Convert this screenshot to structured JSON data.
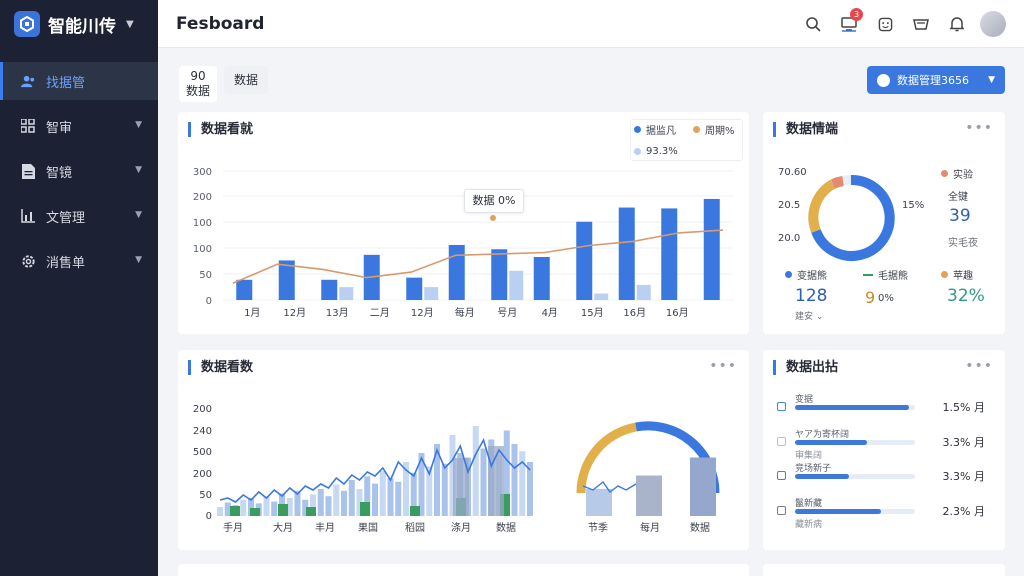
{
  "brand": {
    "name": "智能川传"
  },
  "sidebar": {
    "items": [
      {
        "label": "找据管",
        "icon": "users-icon",
        "active": true
      },
      {
        "label": "智审",
        "icon": "grid-icon",
        "active": false
      },
      {
        "label": "智镜",
        "icon": "document-icon",
        "active": false
      },
      {
        "label": "文管理",
        "icon": "bar-chart-icon",
        "active": false
      },
      {
        "label": "消售单",
        "icon": "gear-icon",
        "active": false
      }
    ]
  },
  "topbar": {
    "title": "Fesboard",
    "notification_count": "3"
  },
  "subheader": {
    "pill_a_num": "90",
    "pill_a_label": "数据",
    "pill_b_label": "数据",
    "primary_button": "数据管理3656"
  },
  "colors": {
    "accent": "#3a78e0",
    "orange": "#e0a35a",
    "light_blue": "#b9d0f2",
    "green": "#3a9d5f",
    "gold": "#e2b04a"
  },
  "card1": {
    "title": "数据看就",
    "legend": [
      {
        "label": "据监凡",
        "color": "#3a78e0"
      },
      {
        "label": "周期%",
        "color": "#e0a35a"
      },
      {
        "label": "93.3%",
        "color": "#b9d0f2"
      }
    ],
    "tooltip": "数据 0%"
  },
  "card2": {
    "title": "数据情端",
    "ring_labels": [
      "70.60",
      "20.5",
      "20.0"
    ],
    "ring_pct": "15%",
    "side_legend": "实验",
    "side_label": "全键",
    "side_value": "39",
    "side_sub": "实毛夜",
    "stats": [
      {
        "label": "变据熊",
        "value": "128",
        "sub": "建安 ⌄",
        "color": "#3a78e0",
        "value_color": "#2c5fb8"
      },
      {
        "label": "毛据熊",
        "value": "9",
        "value_suffix": "0%",
        "color": "#3a9d5f",
        "value_color": "#c98a2b"
      },
      {
        "label": "苹趣",
        "value": "32%",
        "color": "#e0a35a",
        "value_color": "#2f9a8a"
      }
    ]
  },
  "card3": {
    "title": "数据看数"
  },
  "card4": {
    "title": "数据出拈",
    "rows": [
      {
        "label": "变据",
        "value": "1.5% 月",
        "fill": 0.95,
        "sub": ""
      },
      {
        "label": "ヤア为寄杯阔",
        "value": "3.3% 月",
        "fill": 0.6,
        "sub": "审集阔"
      },
      {
        "label": "竞场新子",
        "value": "3.3% 月",
        "fill": 0.45,
        "sub": ""
      },
      {
        "label": "鬣新藏",
        "value": "2.3% 月",
        "fill": 0.72,
        "sub": "藏新病"
      }
    ]
  },
  "chart_data": [
    {
      "type": "bar",
      "categories": [
        "1月",
        "12月",
        "13月",
        "二月",
        "12月",
        "每月",
        "号月",
        "4月",
        "15月",
        "16月",
        "16月"
      ],
      "series": [
        {
          "name": "据监凡",
          "values": [
            47,
            92,
            47,
            105,
            52,
            128,
            118,
            100,
            182,
            215,
            213,
            235
          ]
        },
        {
          "name": "93.3%",
          "values": [
            0,
            0,
            30,
            0,
            30,
            0,
            68,
            0,
            15,
            35,
            0,
            0
          ]
        },
        {
          "name": "周期%",
          "values": [
            60,
            128,
            110,
            80,
            100,
            160,
            165,
            170,
            195,
            210,
            240,
            250
          ]
        }
      ],
      "y_ticks": [
        "0",
        "50",
        "100",
        "100",
        "200",
        "300"
      ],
      "ylim": [
        0,
        300
      ]
    },
    {
      "type": "area",
      "x_ticks": [
        "手月",
        "大月",
        "丰月",
        "果国",
        "稻园",
        "涤月",
        "数据"
      ],
      "y_ticks": [
        "0",
        "50",
        "200",
        "500",
        "240",
        "200"
      ],
      "ylim": [
        0,
        240
      ]
    },
    {
      "type": "bar",
      "x_ticks": [
        "节季",
        "每月",
        "数据"
      ],
      "values": [
        30,
        45,
        65
      ],
      "ylim": [
        0,
        100
      ]
    }
  ]
}
